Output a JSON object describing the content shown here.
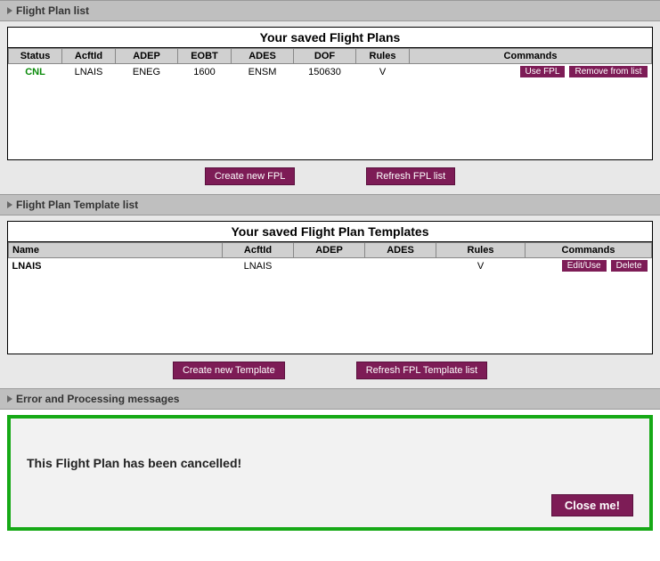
{
  "sections": {
    "fpl_list": "Flight Plan list",
    "tpl_list": "Flight Plan Template list",
    "msgs": "Error and Processing messages"
  },
  "fplTable": {
    "title": "Your saved Flight Plans",
    "headers": [
      "Status",
      "AcftId",
      "ADEP",
      "EOBT",
      "ADES",
      "DOF",
      "Rules",
      "Commands"
    ],
    "row": {
      "status": "CNL",
      "acftId": "LNAIS",
      "adep": "ENEG",
      "eobt": "1600",
      "ades": "ENSM",
      "dof": "150630",
      "rules": "V",
      "cmd_use": "Use FPL",
      "cmd_remove": "Remove from list"
    },
    "btn_create": "Create new FPL",
    "btn_refresh": "Refresh FPL list"
  },
  "tplTable": {
    "title": "Your saved Flight Plan Templates",
    "headers": [
      "Name",
      "AcftId",
      "ADEP",
      "ADES",
      "Rules",
      "Commands"
    ],
    "row": {
      "name": "LNAIS",
      "acftId": "LNAIS",
      "adep": "",
      "ades": "",
      "rules": "V",
      "cmd_edit": "Edit/Use",
      "cmd_delete": "Delete"
    },
    "btn_create": "Create new Template",
    "btn_refresh": "Refresh FPL Template list"
  },
  "message": {
    "text": "This Flight Plan has been cancelled!",
    "close": "Close me!"
  }
}
